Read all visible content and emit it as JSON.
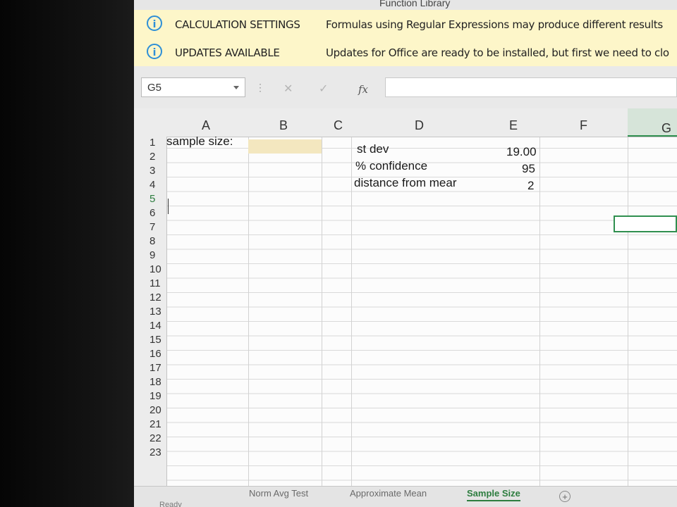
{
  "ribbon": {
    "group_label": "Function Library"
  },
  "message_bars": [
    {
      "icon": "info-icon",
      "icon_glyph": "i",
      "title": "CALCULATION SETTINGS",
      "text": "Formulas using Regular Expressions may produce different results"
    },
    {
      "icon": "info-icon",
      "icon_glyph": "i",
      "title": "UPDATES AVAILABLE",
      "text": "Updates for Office are ready to be installed, but first we need to clo"
    }
  ],
  "formula_bar": {
    "name_box": "G5",
    "fx_label": "fx",
    "cancel_glyph": "✕",
    "enter_glyph": "✓",
    "dots": "⋮",
    "formula": ""
  },
  "columns": [
    "A",
    "B",
    "C",
    "D",
    "E",
    "F",
    "G"
  ],
  "rows": [
    "1",
    "2",
    "3",
    "4",
    "5",
    "6",
    "7",
    "8",
    "9",
    "10",
    "11",
    "12",
    "13",
    "14",
    "15",
    "16",
    "17",
    "18",
    "19",
    "20",
    "21",
    "22",
    "23"
  ],
  "selected_row": "5",
  "cells": {
    "A1": "sample size:",
    "D1": "st dev",
    "E1": "19.00",
    "D2": "% confidence",
    "E2": "95",
    "D3": "distance from mear",
    "E3": "2"
  },
  "sheet_tabs": [
    "Norm Avg Test",
    "Approximate Mean",
    "Sample Size"
  ],
  "active_tab": "Sample Size",
  "add_sheet_glyph": "+",
  "status": "Ready",
  "colors": {
    "accent": "#2d7d3f",
    "message_bar": "#fdf6c9",
    "info_icon": "#2e8fd6"
  }
}
